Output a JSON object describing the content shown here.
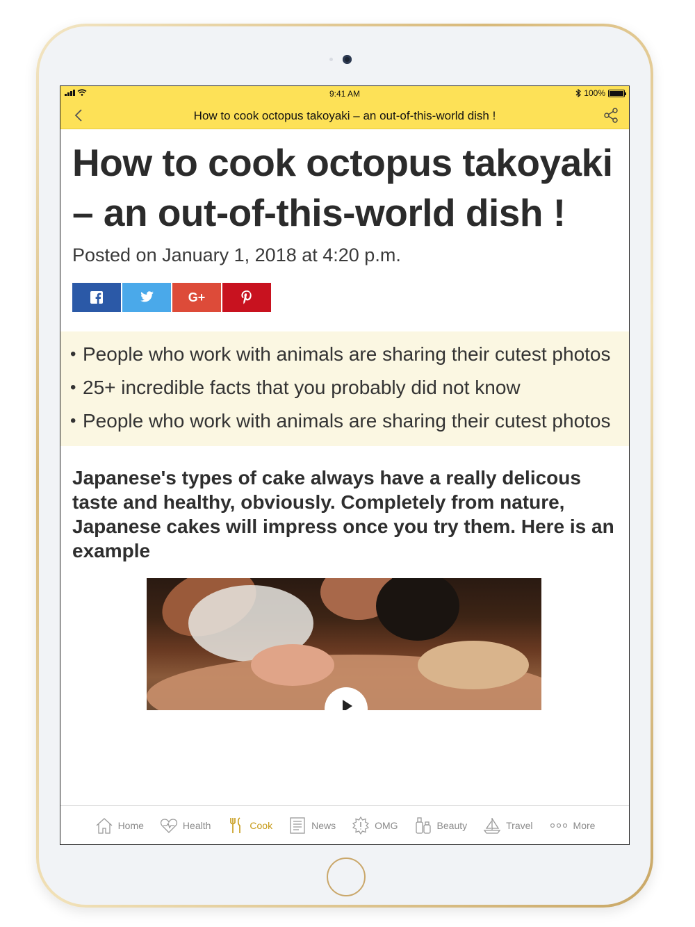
{
  "status_bar": {
    "time": "9:41 AM",
    "battery": "100%",
    "battery_level": 1.0
  },
  "nav": {
    "title": "How to cook octopus takoyaki – an out-of-this-world dish !"
  },
  "article": {
    "title": "How to cook octopus takoyaki – an out-of-this-world dish !",
    "posted": "Posted on January 1, 2018 at 4:20 p.m.",
    "social": [
      {
        "name": "facebook",
        "label": "f",
        "color": "#2b59a7"
      },
      {
        "name": "twitter",
        "label": "",
        "color": "#4aa9ea"
      },
      {
        "name": "google-plus",
        "label": "G+",
        "color": "#dd4b39"
      },
      {
        "name": "pinterest",
        "label": "p",
        "color": "#c8121f"
      }
    ],
    "related": [
      "People who work with animals are sharing their cutest photos",
      "25+ incredible facts that you probably did not know",
      "People who work with animals are sharing their cutest photos"
    ],
    "lead": "Japanese's types of cake always have a really delicous taste and healthy, obviously. Completely from nature, Japanese cakes will impress once you try them. Here is an example"
  },
  "tabs": [
    {
      "label": "Home",
      "icon": "home-icon",
      "active": false
    },
    {
      "label": "Health",
      "icon": "heart-icon",
      "active": false
    },
    {
      "label": "Cook",
      "icon": "cutlery-icon",
      "active": true
    },
    {
      "label": "News",
      "icon": "newspaper-icon",
      "active": false
    },
    {
      "label": "OMG",
      "icon": "omg-icon",
      "active": false
    },
    {
      "label": "Beauty",
      "icon": "beauty-icon",
      "active": false
    },
    {
      "label": "Travel",
      "icon": "sailboat-icon",
      "active": false
    },
    {
      "label": "More",
      "icon": "more-icon",
      "active": false
    }
  ],
  "colors": {
    "accent": "#fde157",
    "active_tab": "#c69a17",
    "related_bg": "#fbf7e2"
  }
}
